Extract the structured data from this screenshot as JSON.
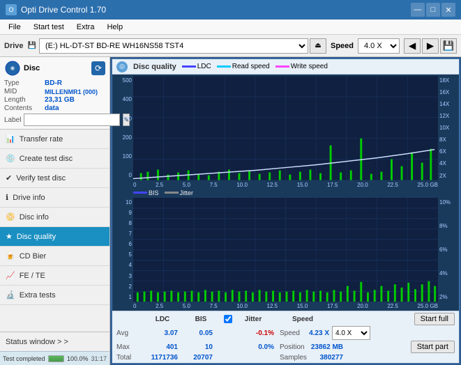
{
  "titlebar": {
    "title": "Opti Drive Control 1.70",
    "minimize": "—",
    "maximize": "□",
    "close": "✕"
  },
  "menubar": {
    "items": [
      "File",
      "Start test",
      "Extra",
      "Help"
    ]
  },
  "drivebar": {
    "label": "Drive",
    "drive_value": "(E:) HL-DT-ST BD-RE  WH16NS58 TST4",
    "speed_label": "Speed",
    "speed_value": "4.0 X"
  },
  "disc": {
    "title": "Disc",
    "type_label": "Type",
    "type_value": "BD-R",
    "mid_label": "MID",
    "mid_value": "MILLENMR1 (000)",
    "length_label": "Length",
    "length_value": "23,31 GB",
    "contents_label": "Contents",
    "contents_value": "data",
    "label_label": "Label",
    "label_value": ""
  },
  "nav": {
    "items": [
      {
        "id": "transfer-rate",
        "label": "Transfer rate",
        "icon": "📊"
      },
      {
        "id": "create-test-disc",
        "label": "Create test disc",
        "icon": "💿"
      },
      {
        "id": "verify-test-disc",
        "label": "Verify test disc",
        "icon": "✔"
      },
      {
        "id": "drive-info",
        "label": "Drive info",
        "icon": "ℹ"
      },
      {
        "id": "disc-info",
        "label": "Disc info",
        "icon": "📀"
      },
      {
        "id": "disc-quality",
        "label": "Disc quality",
        "icon": "★",
        "active": true
      },
      {
        "id": "cd-bier",
        "label": "CD Bier",
        "icon": "🍺"
      },
      {
        "id": "fe-te",
        "label": "FE / TE",
        "icon": "📈"
      },
      {
        "id": "extra-tests",
        "label": "Extra tests",
        "icon": "🔬"
      }
    ]
  },
  "status_window": {
    "label": "Status window > >"
  },
  "chart": {
    "title": "Disc quality",
    "legend": {
      "ldc": "LDC",
      "read": "Read speed",
      "write": "Write speed",
      "bis": "BIS",
      "jitter": "Jitter"
    },
    "top_chart": {
      "y_max": 500,
      "y_axis": [
        500,
        400,
        300,
        200,
        100,
        0
      ],
      "y2_axis": [
        "18X",
        "16X",
        "14X",
        "12X",
        "10X",
        "8X",
        "6X",
        "4X",
        "2X"
      ],
      "x_axis": [
        0,
        2.5,
        5.0,
        7.5,
        10.0,
        12.5,
        15.0,
        17.5,
        20.0,
        22.5,
        25.0
      ]
    },
    "bottom_chart": {
      "y_max": 10,
      "y_axis": [
        10,
        9,
        8,
        7,
        6,
        5,
        4,
        3,
        2,
        1
      ],
      "y2_axis": [
        "10%",
        "8%",
        "6%",
        "4%",
        "2%"
      ],
      "x_axis": [
        0,
        2.5,
        5.0,
        7.5,
        10.0,
        12.5,
        15.0,
        17.5,
        20.0,
        22.5,
        25.0
      ]
    }
  },
  "stats": {
    "columns": [
      "",
      "LDC",
      "BIS",
      "",
      "Jitter",
      "Speed",
      ""
    ],
    "avg_label": "Avg",
    "avg_ldc": "3.07",
    "avg_bis": "0.05",
    "avg_jitter": "-0.1%",
    "max_label": "Max",
    "max_ldc": "401",
    "max_bis": "10",
    "max_jitter": "0.0%",
    "total_label": "Total",
    "total_ldc": "1171736",
    "total_bis": "20707",
    "speed_label": "Speed",
    "speed_value": "4.23 X",
    "speed_select": "4.0 X",
    "position_label": "Position",
    "position_value": "23862 MB",
    "samples_label": "Samples",
    "samples_value": "380277",
    "jitter_checked": true
  },
  "buttons": {
    "start_full": "Start full",
    "start_part": "Start part"
  },
  "progress": {
    "status": "Test completed",
    "value": 100,
    "percent": "100.0%",
    "time": "31:17"
  }
}
